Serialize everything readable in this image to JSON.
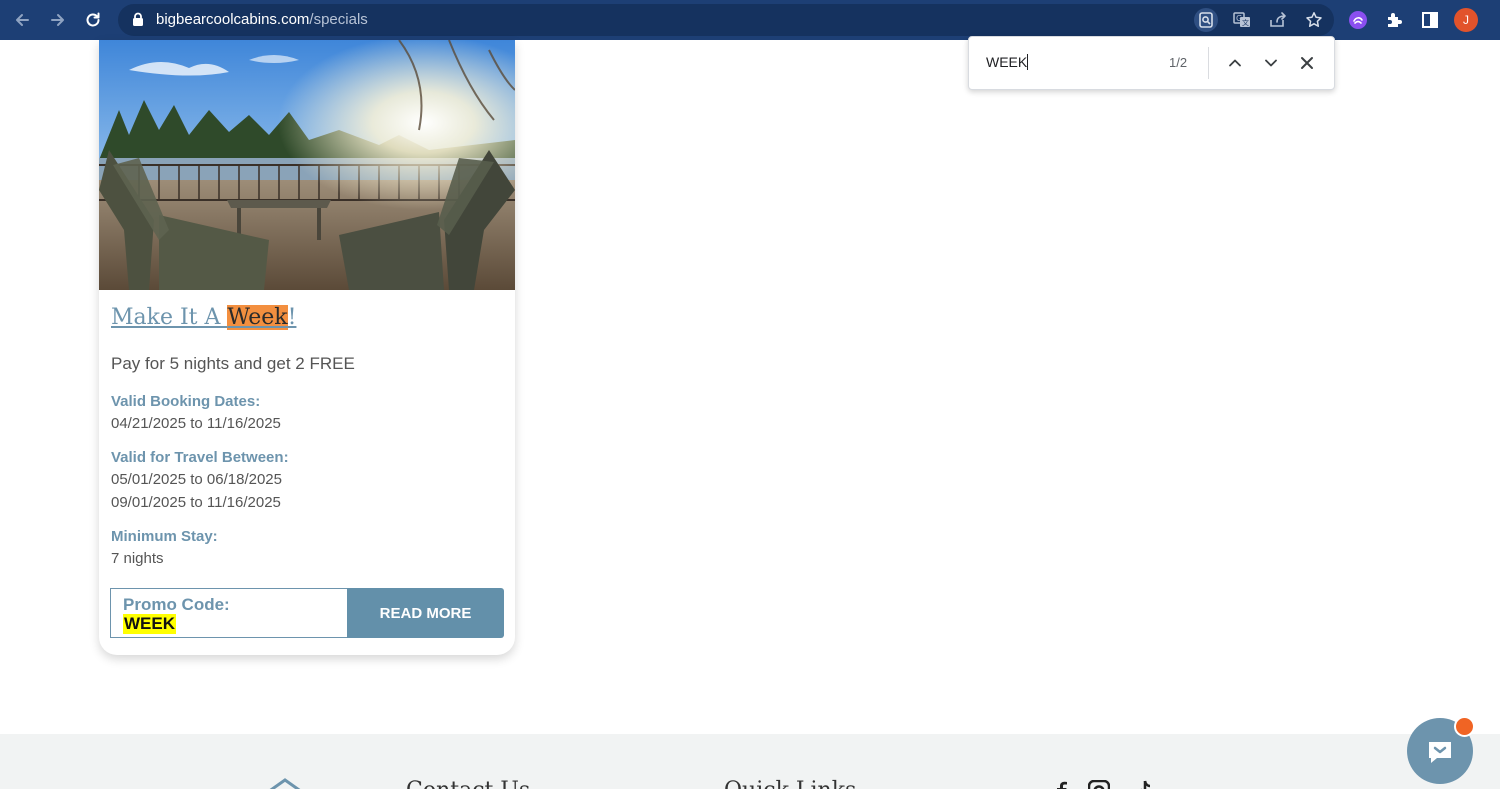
{
  "browser": {
    "url_domain": "bigbearcoolcabins.com",
    "url_path": "/specials",
    "profile_initial": "J",
    "colors": {
      "toolbar": "#1d3f75",
      "omnibox": "#15325f",
      "avatar": "#e2532b"
    }
  },
  "find_bar": {
    "query": "WEEK",
    "count": "1/2"
  },
  "card": {
    "title_prefix": "Make It A ",
    "title_highlight": "Week",
    "title_suffix": "!",
    "description": "Pay for 5 nights and get 2 FREE",
    "booking_label": "Valid Booking Dates:",
    "booking_value": "04/21/2025 to 11/16/2025",
    "travel_label": "Valid for Travel Between:",
    "travel_values": [
      "05/01/2025 to 06/18/2025",
      "09/01/2025 to 11/16/2025"
    ],
    "min_stay_label": "Minimum Stay:",
    "min_stay_value": "7 nights",
    "promo_label": "Promo Code:",
    "promo_code": "WEEK",
    "read_more": "READ MORE",
    "accent_color": "#6d94ad"
  },
  "footer": {
    "headings": [
      "Contact Us",
      "Quick Links"
    ]
  }
}
